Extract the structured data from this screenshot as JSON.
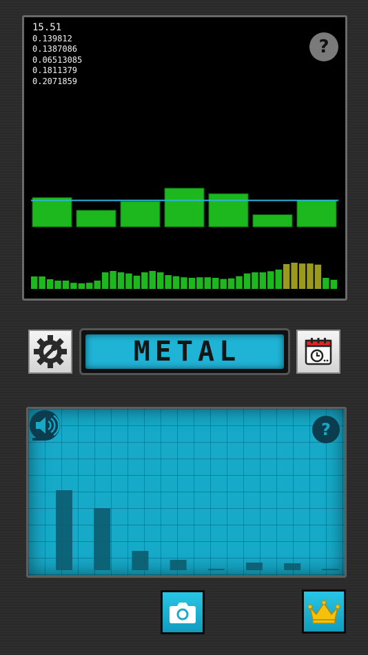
{
  "scope": {
    "readout": [
      "15.51",
      "0.139812",
      "0.1387086",
      "0.06513085",
      "0.1811379",
      "0.2071859"
    ],
    "help_label": "?",
    "band_levels": [
      0.53,
      0.3,
      0.46,
      0.7,
      0.6,
      0.22,
      0.48
    ],
    "threshold_level": 0.48,
    "fine_levels": [
      0.45,
      0.45,
      0.35,
      0.3,
      0.3,
      0.22,
      0.2,
      0.22,
      0.3,
      0.6,
      0.65,
      0.6,
      0.56,
      0.48,
      0.6,
      0.65,
      0.6,
      0.5,
      0.46,
      0.42,
      0.4,
      0.42,
      0.42,
      0.4,
      0.36,
      0.38,
      0.46,
      0.56,
      0.6,
      0.6,
      0.64,
      0.7,
      0.9,
      0.95,
      0.92,
      0.92,
      0.88,
      0.4,
      0.33
    ]
  },
  "mode": {
    "label": "METAL"
  },
  "spectrum": {
    "help_label": "?",
    "levels": [
      0.58,
      0.45,
      0.14,
      0.075,
      0.01,
      0.055,
      0.05,
      0.01
    ]
  },
  "colors": {
    "accent": "#1fb3d6",
    "bar_green": "#1db81d",
    "bar_olive": "#9a9a1e",
    "threshold_line": "#29b6d8",
    "spectrum_bar": "#0d5d70"
  },
  "icons": {
    "settings": "gear-wrench-icon",
    "calendar": "calendar-clock-icon",
    "antenna": "satellite-dish-icon",
    "sound": "speaker-icon",
    "camera": "camera-icon",
    "premium": "crown-icon"
  }
}
